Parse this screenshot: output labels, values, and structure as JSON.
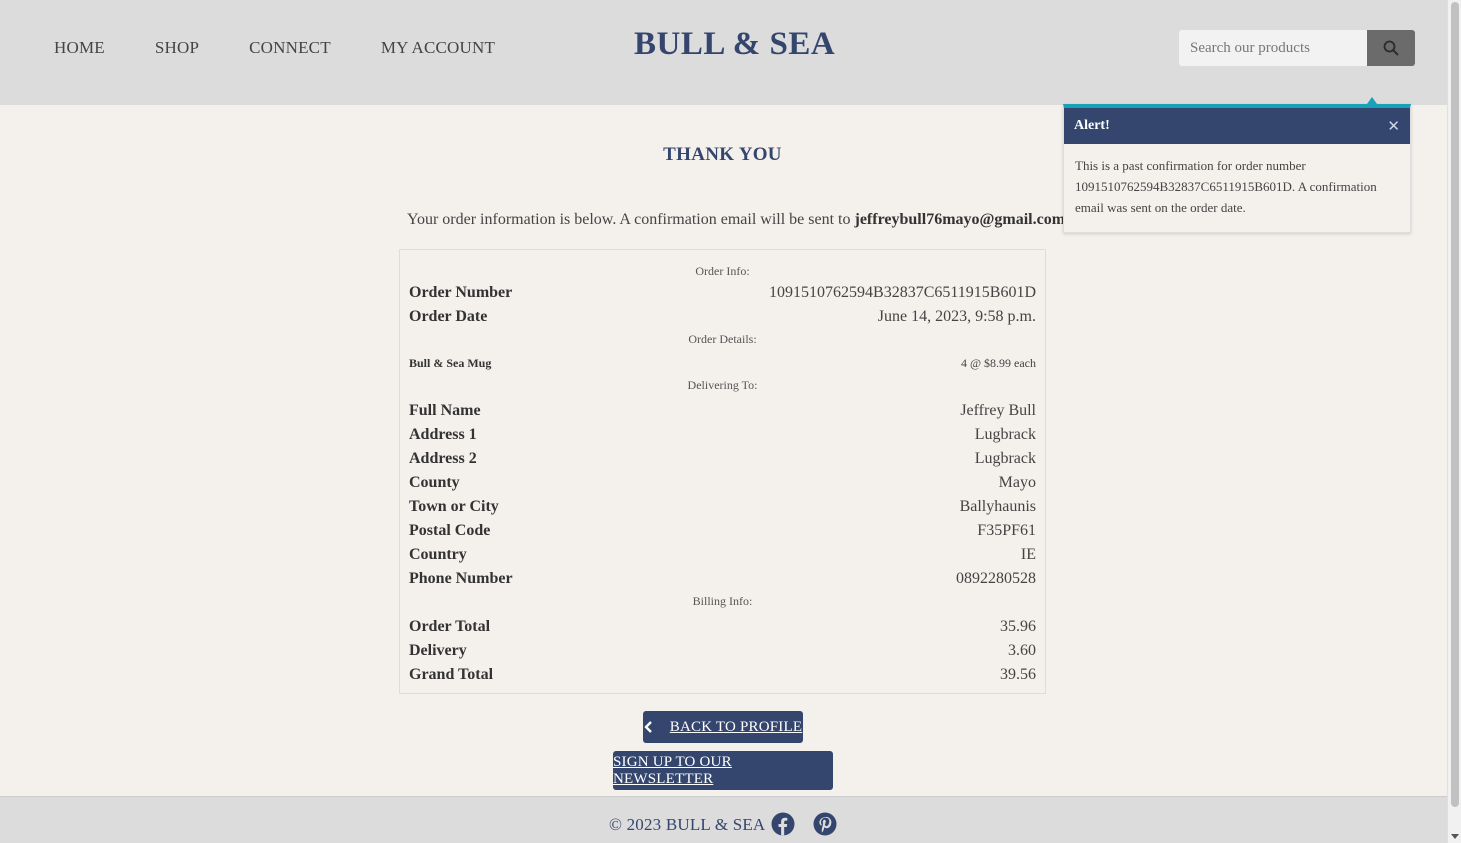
{
  "nav": {
    "items": [
      {
        "label": "HOME"
      },
      {
        "label": "SHOP"
      },
      {
        "label": "CONNECT"
      },
      {
        "label": "MY ACCOUNT"
      }
    ]
  },
  "brand": "BULL & SEA",
  "search": {
    "placeholder": "Search our products",
    "icon": "search-icon"
  },
  "page": {
    "title": "THANK YOU",
    "intro_prefix": "Your order information is below. A confirmation email will be sent to ",
    "email": "jeffreybull76mayo@gmail.com",
    "intro_suffix": "."
  },
  "order": {
    "sections": {
      "order_info": "Order Info:",
      "order_details": "Order Details:",
      "delivering_to": "Delivering To:",
      "billing_info": "Billing Info:"
    },
    "info": [
      {
        "label": "Order Number",
        "value": "1091510762594B32837C6511915B601D"
      },
      {
        "label": "Order Date",
        "value": "June 14, 2023, 9:58 p.m."
      }
    ],
    "items": [
      {
        "name": "Bull & Sea Mug",
        "qty_price": "4 @ $8.99 each"
      }
    ],
    "delivery": [
      {
        "label": "Full Name",
        "value": "Jeffrey Bull"
      },
      {
        "label": "Address 1",
        "value": "Lugbrack"
      },
      {
        "label": "Address 2",
        "value": "Lugbrack"
      },
      {
        "label": "County",
        "value": "Mayo"
      },
      {
        "label": "Town or City",
        "value": "Ballyhaunis"
      },
      {
        "label": "Postal Code",
        "value": "F35PF61"
      },
      {
        "label": "Country",
        "value": "IE"
      },
      {
        "label": "Phone Number",
        "value": "0892280528"
      }
    ],
    "billing": [
      {
        "label": "Order Total",
        "value": "35.96"
      },
      {
        "label": "Delivery",
        "value": "3.60"
      },
      {
        "label": "Grand Total",
        "value": "39.56"
      }
    ]
  },
  "buttons": {
    "back": "BACK TO PROFILE",
    "newsletter": "SIGN UP TO OUR NEWSLETTER"
  },
  "footer": {
    "copyright": "© 2023 BULL & SEA"
  },
  "alert": {
    "title": "Alert!",
    "message": "This is a past confirmation for order number 1091510762594B32837C6511915B601D. A confirmation email was sent on the order date."
  },
  "colors": {
    "brand": "#34466e",
    "accent": "#17a2b8",
    "header_bg": "#dcdcdc",
    "page_bg": "#f4f0ec"
  }
}
